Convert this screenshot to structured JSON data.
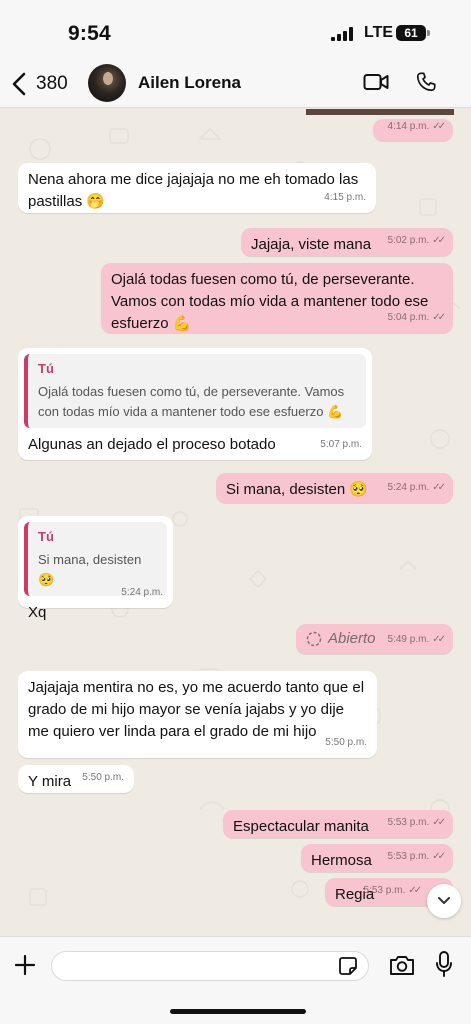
{
  "status_bar": {
    "time": "9:54",
    "network": "LTE",
    "battery": "61"
  },
  "header": {
    "back_count": "380",
    "contact_name": "Ailen Lorena"
  },
  "messages": [
    {
      "dir": "out",
      "time": "4:14 p.m."
    },
    {
      "dir": "in",
      "text": "Nena ahora me dice jajajaja no me eh tomado las pastillas 🤭",
      "time": "4:15 p.m."
    },
    {
      "dir": "out",
      "text": "Jajaja, viste mana",
      "time": "5:02 p.m."
    },
    {
      "dir": "out",
      "text": "Ojalá todas fuesen  como tú, de perseverante. Vamos con todas mío vida a mantener todo ese esfuerzo 💪",
      "time": "5:04 p.m."
    },
    {
      "dir": "in",
      "quote_author": "Tú",
      "quote_text": "Ojalá todas fuesen  como tú, de perseverante. Vamos con todas mío vida a mantener todo ese esfuerzo 💪",
      "text": "Algunas an dejado el proceso botado",
      "time": "5:07 p.m."
    },
    {
      "dir": "out",
      "text": "Si mana, desisten 🥺",
      "time": "5:24 p.m."
    },
    {
      "dir": "in",
      "quote_author": "Tú",
      "quote_text": "Si mana, desisten 🥺",
      "text": "Xq",
      "time": "5:24 p.m."
    },
    {
      "dir": "out",
      "text": "Abierto",
      "time": "5:49 p.m."
    },
    {
      "dir": "in",
      "text": "Jajajaja mentira no es, yo me acuerdo tanto que el grado de mi hijo mayor se venía jajabs y yo dije me quiero ver linda para el grado de mi hijo",
      "time": "5:50 p.m."
    },
    {
      "dir": "in",
      "text": "Y mira",
      "time": "5:50 p.m."
    },
    {
      "dir": "out",
      "text": "Espectacular manita",
      "time": "5:53 p.m."
    },
    {
      "dir": "out",
      "text": "Hermosa",
      "time": "5:53 p.m."
    },
    {
      "dir": "out",
      "text": "Regia",
      "time": "5:53 p.m."
    }
  ],
  "composer": {
    "value": "",
    "placeholder": ""
  },
  "colors": {
    "outgoing_bubble": "#f8c4cf",
    "incoming_bubble": "#ffffff",
    "quote_accent": "#cc3b68",
    "wallpaper": "#efeae2"
  },
  "icons": [
    "chevron-left-icon",
    "video-icon",
    "phone-icon",
    "plus-icon",
    "sticker-icon",
    "camera-icon",
    "microphone-icon",
    "chevron-down-icon",
    "double-check-icon",
    "view-once-icon"
  ]
}
